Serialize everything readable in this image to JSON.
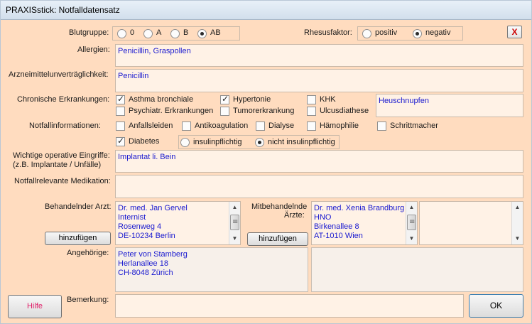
{
  "window": {
    "title": "PRAXISstick: Notfalldatensatz"
  },
  "blood": {
    "label": "Blutgruppe:",
    "options": [
      "0",
      "A",
      "B",
      "AB"
    ],
    "selected": "AB",
    "rh_label": "Rhesusfaktor:",
    "rh_options": [
      "positiv",
      "negativ"
    ],
    "rh_selected": "negativ"
  },
  "close_label": "X",
  "allergies": {
    "label": "Allergien:",
    "value": "Penicillin, Graspollen"
  },
  "intolerance": {
    "label": "Arzneimittelunverträglichkeit:",
    "value": "Penicillin"
  },
  "chronic": {
    "label": "Chronische Erkrankungen:",
    "items": [
      {
        "label": "Asthma bronchiale",
        "checked": true
      },
      {
        "label": "Hypertonie",
        "checked": true
      },
      {
        "label": "KHK",
        "checked": false
      },
      {
        "label": "Psychiatr. Erkrankungen",
        "checked": false
      },
      {
        "label": "Tumorerkrankung",
        "checked": false
      },
      {
        "label": "Ulcusdiathese",
        "checked": false
      }
    ],
    "other": "Heuschnupfen"
  },
  "emergency": {
    "label": "Notfallinformationen:",
    "items": [
      {
        "label": "Anfallsleiden",
        "checked": false
      },
      {
        "label": "Antikoagulation",
        "checked": false
      },
      {
        "label": "Dialyse",
        "checked": false
      },
      {
        "label": "Hämophilie",
        "checked": false
      },
      {
        "label": "Schrittmacher",
        "checked": false
      }
    ],
    "diabetes": {
      "label": "Diabetes",
      "checked": true
    },
    "insulin_options": [
      "insulinpflichtig",
      "nicht insulinpflichtig"
    ],
    "insulin_selected": "nicht insulinpflichtig"
  },
  "surgery": {
    "label_line1": "Wichtige operative Eingriffe:",
    "label_line2": "(z.B. Implantate / Unfälle)",
    "value": "Implantat li. Bein"
  },
  "medication": {
    "label": "Notfallrelevante Medikation:",
    "value": ""
  },
  "doctor": {
    "label": "Behandelnder Arzt:",
    "lines": [
      "Dr. med. Jan Gervel",
      "Internist",
      "Rosenweg 4",
      "DE-10234 Berlin"
    ],
    "add_label": "hinzufügen"
  },
  "codoctor": {
    "label_line1": "Mitbehandelnde",
    "label_line2": "Ärzte:",
    "lines": [
      "Dr. med. Xenia Brandburg",
      "HNO",
      "Birkenallee 8",
      "AT-1010 Wien"
    ],
    "add_label": "hinzufügen"
  },
  "relatives": {
    "label": "Angehörige:",
    "lines": [
      "Peter von Stamberg",
      "Herlanallee 18",
      "CH-8048 Zürich"
    ]
  },
  "remarks": {
    "label": "Bemerkung:",
    "value": ""
  },
  "buttons": {
    "help": "Hilfe",
    "ok": "OK"
  },
  "colors": {
    "background": "#ffdcbf",
    "text_value": "#1a1ad0",
    "help_text": "#e0206a"
  }
}
